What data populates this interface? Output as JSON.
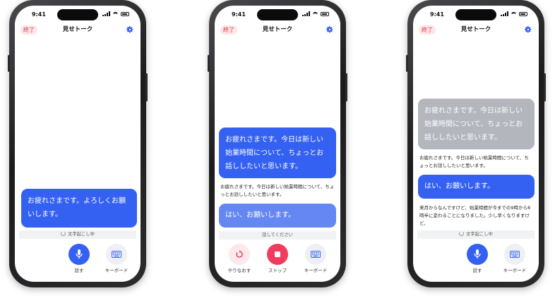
{
  "status": {
    "time": "9:41"
  },
  "nav": {
    "end_label": "終了",
    "title": "見せトーク"
  },
  "screen1": {
    "bubble": "お疲れさまです。よろしくお願いします。",
    "strip": "文字起こし中",
    "buttons": [
      {
        "label": "話す",
        "icon": "mic-icon"
      },
      {
        "label": "キーボード",
        "icon": "keyboard-icon"
      }
    ]
  },
  "screen2": {
    "bubble": "お疲れさまです。今日は新しい始業時間について、ちょっとお話ししたいと思います。",
    "note": "お疲れさまです。今日は新しい始業時間について、ちょっとお話ししたいと思います。",
    "bubble2": "はい、お願いします。",
    "strip": "話してください",
    "buttons": [
      {
        "label": "やりなおす",
        "icon": "redo-icon"
      },
      {
        "label": "ストップ",
        "icon": "stop-icon"
      },
      {
        "label": "キーボード",
        "icon": "keyboard-icon"
      }
    ]
  },
  "screen3": {
    "bubble": "お疲れさまです。今日は新しい始業時間について、ちょっとお話ししたいと思います。",
    "note": "お疲れさまです。今日は新しい始業時間について、ちょっとお話ししたいと思います。",
    "bubble2": "はい、お願いします。",
    "note2": "来月からなんですけど、始業時間が今までの9時から8時半に変わることになりました。少し早くなりますけど、",
    "strip": "文字起こし中",
    "buttons": [
      {
        "label": "話す",
        "icon": "mic-icon"
      },
      {
        "label": "キーボード",
        "icon": "keyboard-icon"
      }
    ]
  },
  "colors": {
    "accent": "#3461f1",
    "stop": "#f03c5f",
    "end": "#e5364b"
  }
}
